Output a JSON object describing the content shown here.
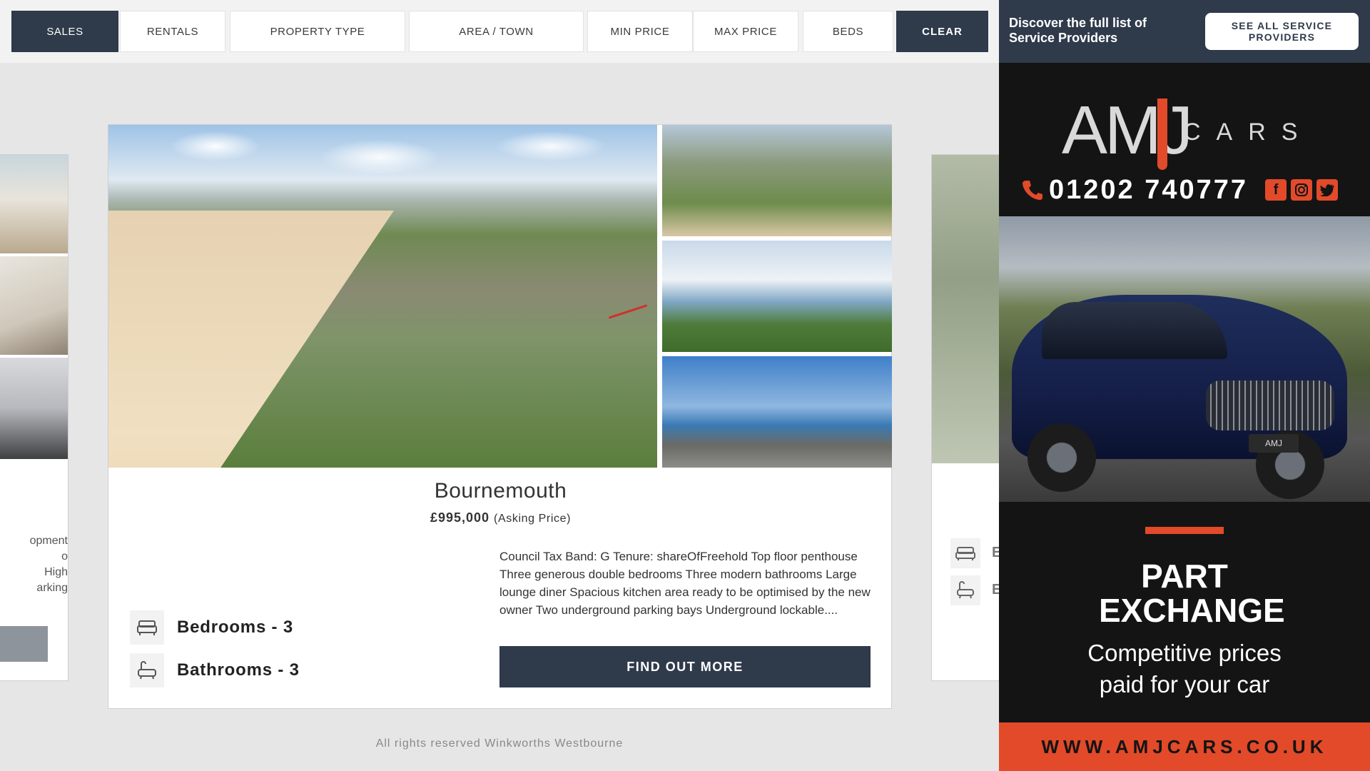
{
  "filters": {
    "sales": "SALES",
    "rentals": "RENTALS",
    "property_type": "PROPERTY TYPE",
    "area_town": "AREA / TOWN",
    "min_price": "MIN PRICE",
    "max_price": "MAX PRICE",
    "beds": "BEDS",
    "clear": "CLEAR"
  },
  "left_card": {
    "text_lines": [
      "opment",
      "o",
      "High",
      "arking"
    ]
  },
  "right_card": {
    "letters": [
      "E",
      "E"
    ]
  },
  "property": {
    "title": "Bournemouth",
    "price": "£995,000",
    "price_qualifier": "(Asking Price)",
    "bedrooms": "Bedrooms - 3",
    "bathrooms": "Bathrooms - 3",
    "description": "Council Tax Band: G Tenure: shareOfFreehold Top floor penthouse Three generous double bedrooms Three modern bathrooms Large lounge diner Spacious kitchen area ready to be optimised by the new owner Two underground parking bays Underground lockable....",
    "find_out_more": "FIND OUT MORE"
  },
  "footer": {
    "text": "All rights reserved Winkworths Westbourne"
  },
  "service_providers": {
    "text": "Discover the full list of Service Providers",
    "button": "SEE ALL SERVICE PROVIDERS"
  },
  "ad": {
    "brand": "AMJ",
    "brand_suffix": "CARS",
    "phone": "01202 740777",
    "headline": "PART EXCHANGE",
    "subheadline": "Competitive prices paid for your car",
    "url": "WWW.AMJCARS.CO.UK",
    "plate": "AMJ",
    "social_icons": [
      "facebook-icon",
      "instagram-icon",
      "twitter-icon"
    ]
  },
  "colors": {
    "navy": "#2f3a4b",
    "accent": "#e24a2a",
    "arrow": "#d0312d"
  }
}
